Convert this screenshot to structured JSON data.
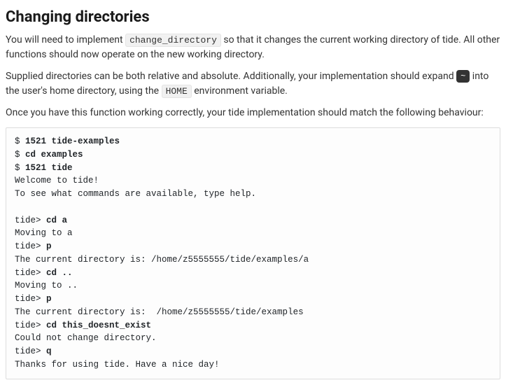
{
  "heading": "Changing directories",
  "para1": {
    "t1": "You will need to implement ",
    "code": "change_directory",
    "t2": " so that it changes the current working directory of tide. All other functions should now operate on the new working directory."
  },
  "para2": {
    "t1": "Supplied directories can be both relative and absolute. Additionally, your implementation should expand ",
    "key": "~",
    "t2": " into the user's home directory, using the ",
    "code": "HOME",
    "t3": " environment variable."
  },
  "para3": "Once you have this function working correctly, your tide implementation should match the following behaviour:",
  "terminal": [
    {
      "prefix": "$ ",
      "bold": "1521 tide-examples",
      "rest": ""
    },
    {
      "prefix": "$ ",
      "bold": "cd examples",
      "rest": ""
    },
    {
      "prefix": "$ ",
      "bold": "1521 tide",
      "rest": ""
    },
    {
      "prefix": "",
      "bold": "",
      "rest": "Welcome to tide!"
    },
    {
      "prefix": "",
      "bold": "",
      "rest": "To see what commands are available, type help."
    },
    {
      "prefix": "",
      "bold": "",
      "rest": ""
    },
    {
      "prefix": "tide> ",
      "bold": "cd a",
      "rest": ""
    },
    {
      "prefix": "",
      "bold": "",
      "rest": "Moving to a"
    },
    {
      "prefix": "tide> ",
      "bold": "p",
      "rest": ""
    },
    {
      "prefix": "",
      "bold": "",
      "rest": "The current directory is: /home/z5555555/tide/examples/a"
    },
    {
      "prefix": "tide> ",
      "bold": "cd ..",
      "rest": ""
    },
    {
      "prefix": "",
      "bold": "",
      "rest": "Moving to .."
    },
    {
      "prefix": "tide> ",
      "bold": "p",
      "rest": ""
    },
    {
      "prefix": "",
      "bold": "",
      "rest": "The current directory is:  /home/z5555555/tide/examples"
    },
    {
      "prefix": "tide> ",
      "bold": "cd this_doesnt_exist",
      "rest": ""
    },
    {
      "prefix": "",
      "bold": "",
      "rest": "Could not change directory."
    },
    {
      "prefix": "tide> ",
      "bold": "q",
      "rest": ""
    },
    {
      "prefix": "",
      "bold": "",
      "rest": "Thanks for using tide. Have a nice day!"
    }
  ]
}
